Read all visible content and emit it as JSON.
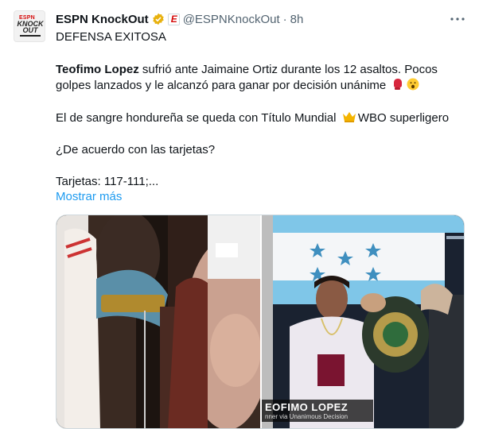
{
  "account": {
    "name": "ESPN KnockOut",
    "handle": "@ESPNKnockOut",
    "separator": "·",
    "time": "8h",
    "avatar_top": "ESPN",
    "avatar_main": "KNOCK OUT",
    "affiliate_badge": "E",
    "verified_color": "#e8b10e"
  },
  "tweet": {
    "line1": "DEFENSA EXITOSA",
    "p2_bold": "Teofimo Lopez",
    "p2_rest": " sufrió ante Jaimaine Ortiz durante los 12 asaltos. Pocos",
    "p2_line2": "golpes lanzados y le alcanzó para ganar por decisión unánime",
    "p3_a": "El de sangre hondureña se queda con Título Mundial",
    "p3_b": "WBO superligero",
    "p4": "¿De acuerdo con las tarjetas?",
    "p5": "Tarjetas: 117-111;...",
    "show_more": "Mostrar más"
  },
  "media": {
    "caption_name": "EOFIMO LOPEZ",
    "caption_sub": "nner via Unanimous Decision"
  },
  "icons": [
    "verified-icon",
    "affiliate-badge-icon",
    "more-icon",
    "boxing-glove-icon",
    "astonished-face-icon",
    "crown-icon"
  ]
}
